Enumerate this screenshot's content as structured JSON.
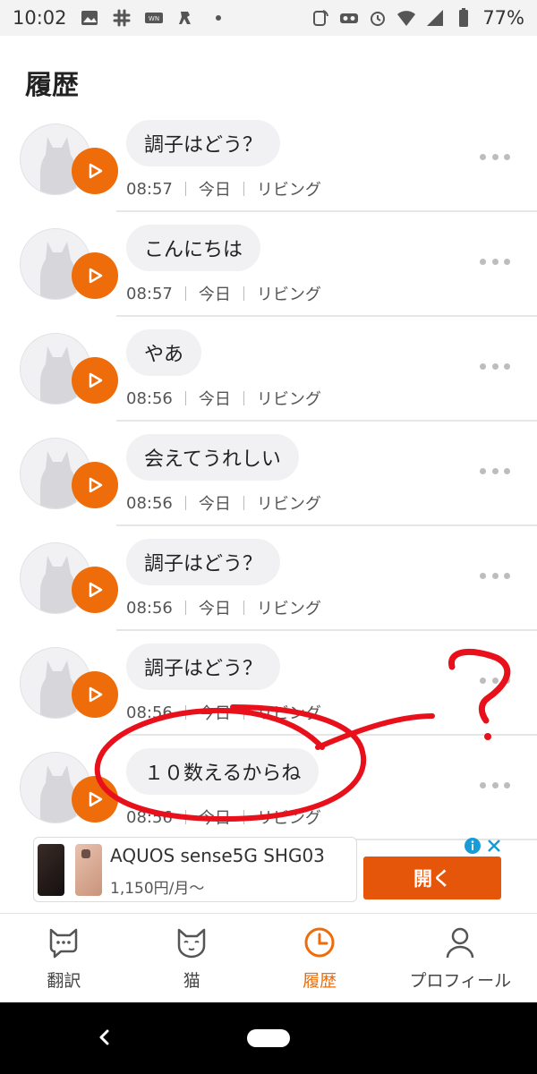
{
  "status_bar": {
    "time": "10:02",
    "battery": "77%",
    "left_icons": [
      "image-icon",
      "slack-icon",
      "app-icon",
      "app-icon",
      "dot-icon"
    ],
    "right_icons": [
      "nfc-icon",
      "vr-icon",
      "alarm-icon",
      "wifi-icon",
      "signal-icon",
      "battery-icon"
    ]
  },
  "page": {
    "title": "履歴"
  },
  "history": [
    {
      "text": "調子はどう？",
      "time": "08:57",
      "day": "今日",
      "room": "リビング"
    },
    {
      "text": "こんにちは",
      "time": "08:57",
      "day": "今日",
      "room": "リビング"
    },
    {
      "text": "やあ",
      "time": "08:56",
      "day": "今日",
      "room": "リビング"
    },
    {
      "text": "会えてうれしい",
      "time": "08:56",
      "day": "今日",
      "room": "リビング"
    },
    {
      "text": "調子はどう？",
      "time": "08:56",
      "day": "今日",
      "room": "リビング"
    },
    {
      "text": "調子はどう？",
      "time": "08:56",
      "day": "今日",
      "room": "リビング"
    },
    {
      "text": "１０数えるからね",
      "time": "08:56",
      "day": "今日",
      "room": "リビング"
    }
  ],
  "ad": {
    "title": "AQUOS sense5G SHG03",
    "price": "1,150円/月〜",
    "open_label": "開く"
  },
  "bottom_nav": {
    "tabs": [
      {
        "label": "翻訳",
        "icon": "translate-cat-bubble-icon"
      },
      {
        "label": "猫",
        "icon": "cat-face-icon"
      },
      {
        "label": "履歴",
        "icon": "clock-icon",
        "active": true
      },
      {
        "label": "プロフィール",
        "icon": "person-icon"
      }
    ]
  },
  "colors": {
    "accent": "#ee6d0a",
    "ad_button": "#e5560b",
    "annotation": "#e8101a"
  }
}
